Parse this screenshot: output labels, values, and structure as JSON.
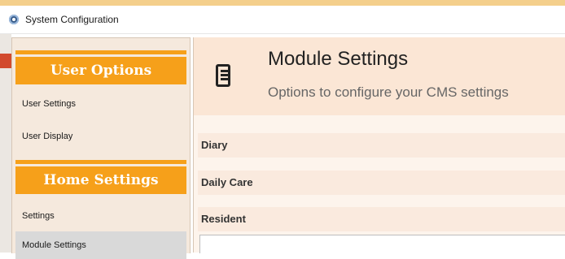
{
  "window": {
    "title": "System Configuration"
  },
  "sidebar": {
    "sections": [
      {
        "title": "User Options",
        "items": [
          "User Settings",
          "User Display"
        ]
      },
      {
        "title": "Home Settings",
        "items": [
          "Settings",
          "Module Settings"
        ]
      }
    ],
    "selected_item": "Module Settings"
  },
  "main": {
    "title": "Module Settings",
    "subtitle": "Options to configure your CMS settings",
    "icon": "document-list-icon",
    "sections": [
      "Diary",
      "Daily Care",
      "Resident"
    ]
  },
  "colors": {
    "accent": "#f6a01a",
    "sidebar_bg": "#f5e9dd",
    "header_bg": "#fbe6d5",
    "selected_bg": "#d9d9d9"
  }
}
